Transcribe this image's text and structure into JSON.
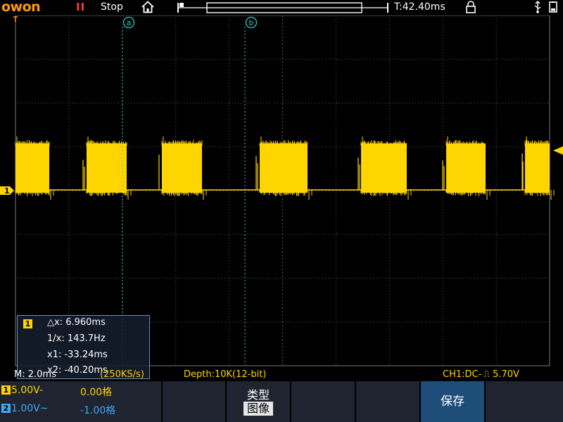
{
  "app": {
    "logo_text": "owon"
  },
  "status_bar": {
    "run_indicator": "II",
    "run_state": "Stop",
    "trigger_time": "T:42.40ms"
  },
  "cursors": {
    "a_label": "a",
    "b_label": "b"
  },
  "channel_markers": {
    "ch1": "1"
  },
  "measurement": {
    "channel": "1",
    "delta_x": "△x: 6.960ms",
    "inv_x": "1/x: 143.7Hz",
    "x1": "x1: -33.24ms",
    "x2": "x2: -40.20ms"
  },
  "info_bar": {
    "timebase": "M: 2.0ms",
    "sample_rate": "(250KS/s)",
    "depth": "Depth:10K(12-bit)",
    "trigger": "CH1:DC- ⎍ 5.70V"
  },
  "channels": [
    {
      "id": "1",
      "volts_div": "5.00V",
      "coupling": "-",
      "offset": "0.00格",
      "color": "#ffd500"
    },
    {
      "id": "2",
      "volts_div": "1.00V",
      "coupling": "~",
      "offset": "-1.00格",
      "color": "#3fa9f5"
    }
  ],
  "menu": {
    "type_title": "类型",
    "type_value": "图像",
    "save_label": "保存"
  },
  "colors": {
    "ch1": "#ffd500",
    "cursor": "#38c9c9",
    "grid": "#5a5a5a",
    "logo": "#ff9a00"
  }
}
